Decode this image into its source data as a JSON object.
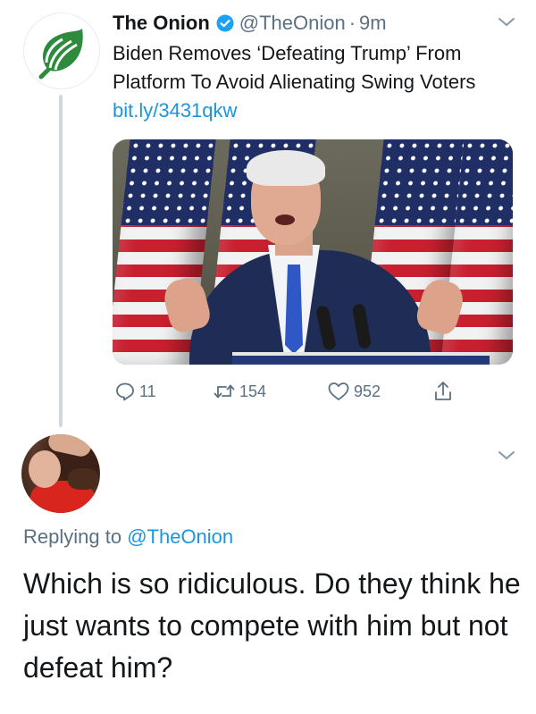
{
  "tweet": {
    "author_name": "The Onion",
    "author_handle": "@TheOnion",
    "separator": "·",
    "time": "9m",
    "text": "Biden Removes ‘Defeating Trump’ From Platform To Avoid Alienating Swing Voters",
    "link": "bit.ly/3431qkw",
    "verified_icon": "verified-badge-icon",
    "avatar_icon": "onion-logo-icon",
    "counts": {
      "replies": "11",
      "retweets": "154",
      "likes": "952"
    }
  },
  "reply": {
    "replying_prefix": "Replying to",
    "replying_to": "@TheOnion",
    "text": "Which is so ridiculous. Do they think he just wants to compete with him but not defeat him?"
  },
  "icons": {
    "reply": "reply-icon",
    "retweet": "retweet-icon",
    "like": "heart-icon",
    "share": "share-icon",
    "more": "chevron-down-icon"
  },
  "colors": {
    "accent": "#1b95e0",
    "verified": "#1da1f2",
    "onion_green": "#2e8b3d",
    "muted_text": "#5b7083",
    "thread_line": "#cfd9de"
  }
}
